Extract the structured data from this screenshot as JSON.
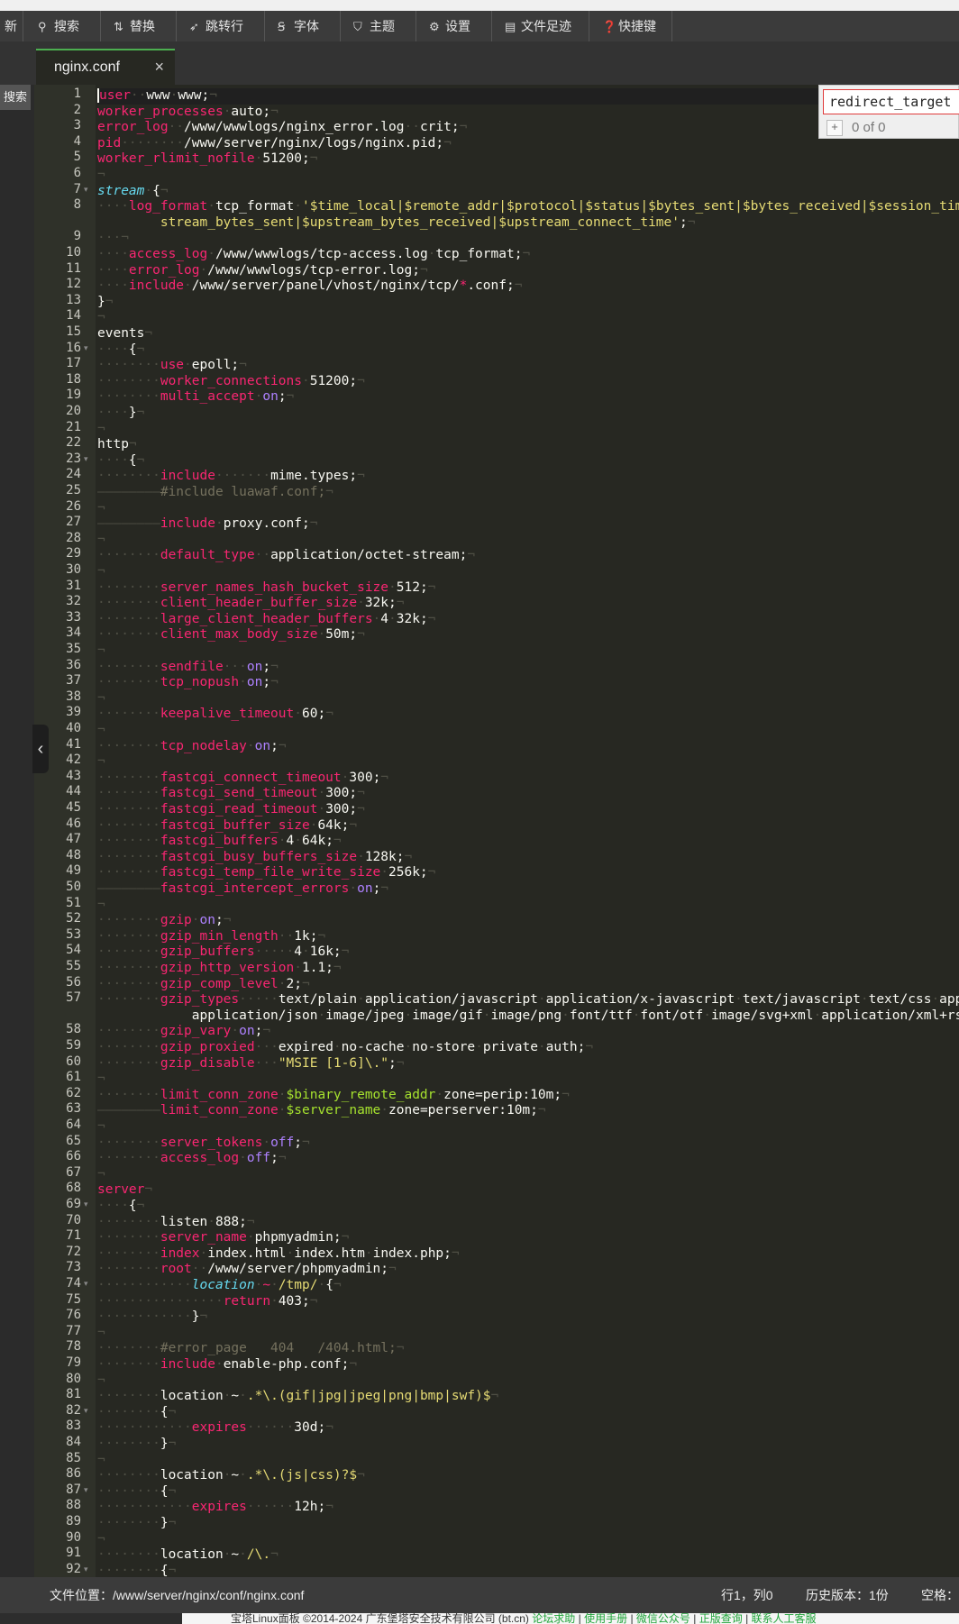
{
  "toolbar": {
    "partial_left": "新",
    "buttons": [
      {
        "label": "搜索",
        "icon": "search-icon",
        "glyph": "⚲"
      },
      {
        "label": "替换",
        "icon": "replace-icon",
        "glyph": "⇅"
      },
      {
        "label": "跳转行",
        "icon": "goto-icon",
        "glyph": "➶"
      },
      {
        "label": "字体",
        "icon": "font-icon",
        "glyph": "Ꞩ"
      },
      {
        "label": "主题",
        "icon": "theme-icon",
        "glyph": "⛉"
      },
      {
        "label": "设置",
        "icon": "gear-icon",
        "glyph": "⚙"
      },
      {
        "label": "文件足迹",
        "icon": "history-icon",
        "glyph": "▤"
      },
      {
        "label": "快捷键",
        "icon": "help-icon",
        "glyph": "❓"
      }
    ]
  },
  "tab": {
    "title": "nginx.conf",
    "close": "×"
  },
  "side_search_label": "搜索",
  "search": {
    "value": "redirect_target",
    "count": "0 of 0",
    "plus": "+"
  },
  "status": {
    "path_label": "文件位置：",
    "path": "/www/server/nginx/conf/nginx.conf",
    "position": "行1，列0",
    "history": "历史版本：1份",
    "indent": "空格："
  },
  "footer": {
    "copyright": "宝塔Linux面板 ©2014-2024 广东堡塔安全技术有限公司 (bt.cn)",
    "links": [
      "论坛求助",
      "使用手册",
      "微信公众号",
      "正版查询",
      "联系人工客服"
    ]
  },
  "editor": {
    "lines": [
      {
        "n": "1",
        "h": "<span class='k'>user</span><span class='w'>··</span>www<span class='w'>·</span>www;<span class='w'>¬</span>"
      },
      {
        "n": "2",
        "h": "<span class='k'>worker_processes</span><span class='w'>·</span>auto;<span class='w'>¬</span>"
      },
      {
        "n": "3",
        "h": "<span class='k'>error_log</span><span class='w'>··</span>/www/wwwlogs/nginx_error.log<span class='w'>··</span>crit;<span class='w'>¬</span>"
      },
      {
        "n": "4",
        "h": "<span class='k'>pid</span><span class='w'>········</span>/www/server/nginx/logs/nginx.pid;<span class='w'>¬</span>"
      },
      {
        "n": "5",
        "h": "<span class='k'>worker_rlimit_nofile</span><span class='w'>·</span>51200;<span class='w'>¬</span>"
      },
      {
        "n": "6",
        "h": "<span class='w'>¬</span>"
      },
      {
        "n": "7",
        "fold": true,
        "h": "<span class='i'>stream</span><span class='w'>·</span>{<span class='w'>¬</span>"
      },
      {
        "n": "8",
        "h": "<span class='w'>····</span><span class='k'>log_format</span><span class='w'>·</span>tcp_format<span class='w'>·</span><span class='s'>'$time_local|$remote_addr|$protocol|$status|$bytes_sent|$bytes_received|$session_time|$upstream_addr|$up</span>"
      },
      {
        "n": "",
        "h": "<span class='s'>        stream_bytes_sent|$upstream_bytes_received|$upstream_connect_time'</span>;<span class='w'>¬</span>"
      },
      {
        "n": "9",
        "h": "<span class='w'>···¬</span>"
      },
      {
        "n": "10",
        "h": "<span class='w'>····</span><span class='k'>access_log</span><span class='w'>·</span>/www/wwwlogs/tcp-access.log<span class='w'>·</span>tcp_format;<span class='w'>¬</span>"
      },
      {
        "n": "11",
        "h": "<span class='w'>····</span><span class='k'>error_log</span><span class='w'>·</span>/www/wwwlogs/tcp-error.log;<span class='w'>¬</span>"
      },
      {
        "n": "12",
        "h": "<span class='w'>····</span><span class='k'>include</span><span class='w'>·</span>/www/server/panel/vhost/nginx/tcp/<span class='k'>*</span>.conf;<span class='w'>¬</span>"
      },
      {
        "n": "13",
        "h": "}<span class='w'>¬</span>"
      },
      {
        "n": "14",
        "h": "<span class='w'>¬</span>"
      },
      {
        "n": "15",
        "h": "events<span class='w'>¬</span>"
      },
      {
        "n": "16",
        "fold": true,
        "h": "<span class='w'>····</span>{<span class='w'>¬</span>"
      },
      {
        "n": "17",
        "h": "<span class='w'>········</span><span class='k'>use</span><span class='w'>·</span>epoll;<span class='w'>¬</span>"
      },
      {
        "n": "18",
        "h": "<span class='w'>········</span><span class='k'>worker_connections</span><span class='w'>·</span>51200;<span class='w'>¬</span>"
      },
      {
        "n": "19",
        "h": "<span class='w'>········</span><span class='k'>multi_accept</span><span class='w'>·</span><span class='n'>on</span>;<span class='w'>¬</span>"
      },
      {
        "n": "20",
        "h": "<span class='w'>····</span>}<span class='w'>¬</span>"
      },
      {
        "n": "21",
        "h": "<span class='w'>¬</span>"
      },
      {
        "n": "22",
        "h": "http<span class='w'>¬</span>"
      },
      {
        "n": "23",
        "fold": true,
        "h": "<span class='w'>····</span>{<span class='w'>¬</span>"
      },
      {
        "n": "24",
        "h": "<span class='w'>········</span><span class='k'>include</span><span class='w'>·······</span>mime.types;<span class='w'>¬</span>"
      },
      {
        "n": "25",
        "h": "<span class='w'>————————</span><span class='c'>#include luawaf.conf;</span><span class='w'>¬</span>"
      },
      {
        "n": "26",
        "h": "<span class='w'>¬</span>"
      },
      {
        "n": "27",
        "h": "<span class='w'>————————</span><span class='k'>include</span><span class='w'>·</span>proxy.conf;<span class='w'>¬</span>"
      },
      {
        "n": "28",
        "h": "<span class='w'>¬</span>"
      },
      {
        "n": "29",
        "h": "<span class='w'>········</span><span class='k'>default_type</span><span class='w'>··</span>application/octet-stream;<span class='w'>¬</span>"
      },
      {
        "n": "30",
        "h": "<span class='w'>¬</span>"
      },
      {
        "n": "31",
        "h": "<span class='w'>········</span><span class='k'>server_names_hash_bucket_size</span><span class='w'>·</span>512;<span class='w'>¬</span>"
      },
      {
        "n": "32",
        "h": "<span class='w'>········</span><span class='k'>client_header_buffer_size</span><span class='w'>·</span>32k;<span class='w'>¬</span>"
      },
      {
        "n": "33",
        "h": "<span class='w'>········</span><span class='k'>large_client_header_buffers</span><span class='w'>·</span>4<span class='w'>·</span>32k;<span class='w'>¬</span>"
      },
      {
        "n": "34",
        "h": "<span class='w'>········</span><span class='k'>client_max_body_size</span><span class='w'>·</span>50m;<span class='w'>¬</span>"
      },
      {
        "n": "35",
        "h": "<span class='w'>¬</span>"
      },
      {
        "n": "36",
        "h": "<span class='w'>········</span><span class='k'>sendfile</span><span class='w'>···</span><span class='n'>on</span>;<span class='w'>¬</span>"
      },
      {
        "n": "37",
        "h": "<span class='w'>········</span><span class='k'>tcp_nopush</span><span class='w'>·</span><span class='n'>on</span>;<span class='w'>¬</span>"
      },
      {
        "n": "38",
        "h": "<span class='w'>¬</span>"
      },
      {
        "n": "39",
        "h": "<span class='w'>········</span><span class='k'>keepalive_timeout</span><span class='w'>·</span>60;<span class='w'>¬</span>"
      },
      {
        "n": "40",
        "h": "<span class='w'>¬</span>"
      },
      {
        "n": "41",
        "h": "<span class='w'>········</span><span class='k'>tcp_nodelay</span><span class='w'>·</span><span class='n'>on</span>;<span class='w'>¬</span>"
      },
      {
        "n": "42",
        "h": "<span class='w'>¬</span>"
      },
      {
        "n": "43",
        "h": "<span class='w'>········</span><span class='k'>fastcgi_connect_timeout</span><span class='w'>·</span>300;<span class='w'>¬</span>"
      },
      {
        "n": "44",
        "h": "<span class='w'>········</span><span class='k'>fastcgi_send_timeout</span><span class='w'>·</span>300;<span class='w'>¬</span>"
      },
      {
        "n": "45",
        "h": "<span class='w'>········</span><span class='k'>fastcgi_read_timeout</span><span class='w'>·</span>300;<span class='w'>¬</span>"
      },
      {
        "n": "46",
        "h": "<span class='w'>········</span><span class='k'>fastcgi_buffer_size</span><span class='w'>·</span>64k;<span class='w'>¬</span>"
      },
      {
        "n": "47",
        "h": "<span class='w'>········</span><span class='k'>fastcgi_buffers</span><span class='w'>·</span>4<span class='w'>·</span>64k;<span class='w'>¬</span>"
      },
      {
        "n": "48",
        "h": "<span class='w'>········</span><span class='k'>fastcgi_busy_buffers_size</span><span class='w'>·</span>128k;<span class='w'>¬</span>"
      },
      {
        "n": "49",
        "h": "<span class='w'>········</span><span class='k'>fastcgi_temp_file_write_size</span><span class='w'>·</span>256k;<span class='w'>¬</span>"
      },
      {
        "n": "50",
        "h": "<span class='w'>————————</span><span class='k'>fastcgi_intercept_errors</span><span class='w'>·</span><span class='n'>on</span>;<span class='w'>¬</span>"
      },
      {
        "n": "51",
        "h": "<span class='w'>¬</span>"
      },
      {
        "n": "52",
        "h": "<span class='w'>········</span><span class='k'>gzip</span><span class='w'>·</span><span class='n'>on</span>;<span class='w'>¬</span>"
      },
      {
        "n": "53",
        "h": "<span class='w'>········</span><span class='k'>gzip_min_length</span><span class='w'>··</span>1k;<span class='w'>¬</span>"
      },
      {
        "n": "54",
        "h": "<span class='w'>········</span><span class='k'>gzip_buffers</span><span class='w'>·····</span>4<span class='w'>·</span>16k;<span class='w'>¬</span>"
      },
      {
        "n": "55",
        "h": "<span class='w'>········</span><span class='k'>gzip_http_version</span><span class='w'>·</span>1.1;<span class='w'>¬</span>"
      },
      {
        "n": "56",
        "h": "<span class='w'>········</span><span class='k'>gzip_comp_level</span><span class='w'>·</span>2;<span class='w'>¬</span>"
      },
      {
        "n": "57",
        "h": "<span class='w'>········</span><span class='k'>gzip_types</span><span class='w'>·····</span>text/plain<span class='w'>·</span>application/javascript<span class='w'>·</span>application/x-javascript<span class='w'>·</span>text/javascript<span class='w'>·</span>text/css<span class='w'>·</span>application/xml<span class='w'>·</span>"
      },
      {
        "n": "",
        "h": "            application/json<span class='w'>·</span>image/jpeg<span class='w'>·</span>image/gif<span class='w'>·</span>image/png<span class='w'>·</span>font/ttf<span class='w'>·</span>font/otf<span class='w'>·</span>image/svg+xml<span class='w'>·</span>application/xml+rss"
      },
      {
        "n": "58",
        "h": "<span class='w'>········</span><span class='k'>gzip_vary</span><span class='w'>·</span><span class='n'>on</span>;<span class='w'>¬</span>"
      },
      {
        "n": "59",
        "h": "<span class='w'>········</span><span class='k'>gzip_proxied</span><span class='w'>···</span>expired<span class='w'>·</span>no-cache<span class='w'>·</span>no-store<span class='w'>·</span>private<span class='w'>·</span>auth;<span class='w'>¬</span>"
      },
      {
        "n": "60",
        "h": "<span class='w'>········</span><span class='k'>gzip_disable</span><span class='w'>···</span><span class='s'>\"MSIE [1-6]\\.\"</span>;<span class='w'>¬</span>"
      },
      {
        "n": "61",
        "h": "<span class='w'>¬</span>"
      },
      {
        "n": "62",
        "h": "<span class='w'>········</span><span class='k'>limit_conn_zone</span><span class='w'>·</span><span class='v'>$binary_remote_addr</span><span class='w'>·</span>zone=perip:10m;<span class='w'>¬</span>"
      },
      {
        "n": "63",
        "h": "<span class='w'>————————</span><span class='k'>limit_conn_zone</span><span class='w'>·</span><span class='v'>$server_name</span><span class='w'>·</span>zone=perserver:10m;<span class='w'>¬</span>"
      },
      {
        "n": "64",
        "h": "<span class='w'>¬</span>"
      },
      {
        "n": "65",
        "h": "<span class='w'>········</span><span class='k'>server_tokens</span><span class='w'>·</span><span class='n'>off</span>;<span class='w'>¬</span>"
      },
      {
        "n": "66",
        "h": "<span class='w'>········</span><span class='k'>access_log</span><span class='w'>·</span><span class='n'>off</span>;<span class='w'>¬</span>"
      },
      {
        "n": "67",
        "h": "<span class='w'>¬</span>"
      },
      {
        "n": "68",
        "h": "<span class='k'>server</span><span class='w'>¬</span>"
      },
      {
        "n": "69",
        "fold": true,
        "h": "<span class='w'>····</span>{<span class='w'>¬</span>"
      },
      {
        "n": "70",
        "h": "<span class='w'>········</span>listen<span class='w'>·</span>888;<span class='w'>¬</span>"
      },
      {
        "n": "71",
        "h": "<span class='w'>········</span><span class='k'>server_name</span><span class='w'>·</span>phpmyadmin;<span class='w'>¬</span>"
      },
      {
        "n": "72",
        "h": "<span class='w'>········</span><span class='k'>index</span><span class='w'>·</span>index.html<span class='w'>·</span>index.htm<span class='w'>·</span>index.php;<span class='w'>¬</span>"
      },
      {
        "n": "73",
        "h": "<span class='w'>········</span><span class='k'>root</span><span class='w'>··</span>/www/server/phpmyadmin;<span class='w'>¬</span>"
      },
      {
        "n": "74",
        "fold": true,
        "h": "<span class='w'>············</span><span class='i'>location</span><span class='w'>·</span><span class='k'>~</span><span class='w'>·</span><span class='s'>/tmp/</span><span class='w'>·</span>{<span class='w'>¬</span>"
      },
      {
        "n": "75",
        "h": "<span class='w'>················</span><span class='k'>return</span><span class='w'>·</span>403;<span class='w'>¬</span>"
      },
      {
        "n": "76",
        "h": "<span class='w'>············</span>}<span class='w'>¬</span>"
      },
      {
        "n": "77",
        "h": "<span class='w'>¬</span>"
      },
      {
        "n": "78",
        "h": "<span class='w'>········</span><span class='c'>#error_page   404   /404.html;</span><span class='w'>¬</span>"
      },
      {
        "n": "79",
        "h": "<span class='w'>········</span><span class='k'>include</span><span class='w'>·</span>enable-php.conf;<span class='w'>¬</span>"
      },
      {
        "n": "80",
        "h": "<span class='w'>¬</span>"
      },
      {
        "n": "81",
        "h": "<span class='w'>········</span>location<span class='w'>·</span>~<span class='w'>·</span><span class='s'>.*\\.(gif|jpg|jpeg|png|bmp|swf)$</span><span class='w'>¬</span>"
      },
      {
        "n": "82",
        "fold": true,
        "h": "<span class='w'>········</span>{<span class='w'>¬</span>"
      },
      {
        "n": "83",
        "h": "<span class='w'>············</span><span class='k'>expires</span><span class='w'>······</span>30d;<span class='w'>¬</span>"
      },
      {
        "n": "84",
        "h": "<span class='w'>········</span>}<span class='w'>¬</span>"
      },
      {
        "n": "85",
        "h": "<span class='w'>¬</span>"
      },
      {
        "n": "86",
        "h": "<span class='w'>········</span>location<span class='w'>·</span>~<span class='w'>·</span><span class='s'>.*\\.(js|css)?$</span><span class='w'>¬</span>"
      },
      {
        "n": "87",
        "fold": true,
        "h": "<span class='w'>········</span>{<span class='w'>¬</span>"
      },
      {
        "n": "88",
        "h": "<span class='w'>············</span><span class='k'>expires</span><span class='w'>······</span>12h;<span class='w'>¬</span>"
      },
      {
        "n": "89",
        "h": "<span class='w'>········</span>}<span class='w'>¬</span>"
      },
      {
        "n": "90",
        "h": "<span class='w'>¬</span>"
      },
      {
        "n": "91",
        "h": "<span class='w'>········</span>location<span class='w'>·</span>~<span class='w'>·</span><span class='s'>/\\.</span><span class='w'>¬</span>"
      },
      {
        "n": "92",
        "fold": true,
        "h": "<span class='w'>········</span>{<span class='w'>¬</span>"
      }
    ]
  }
}
